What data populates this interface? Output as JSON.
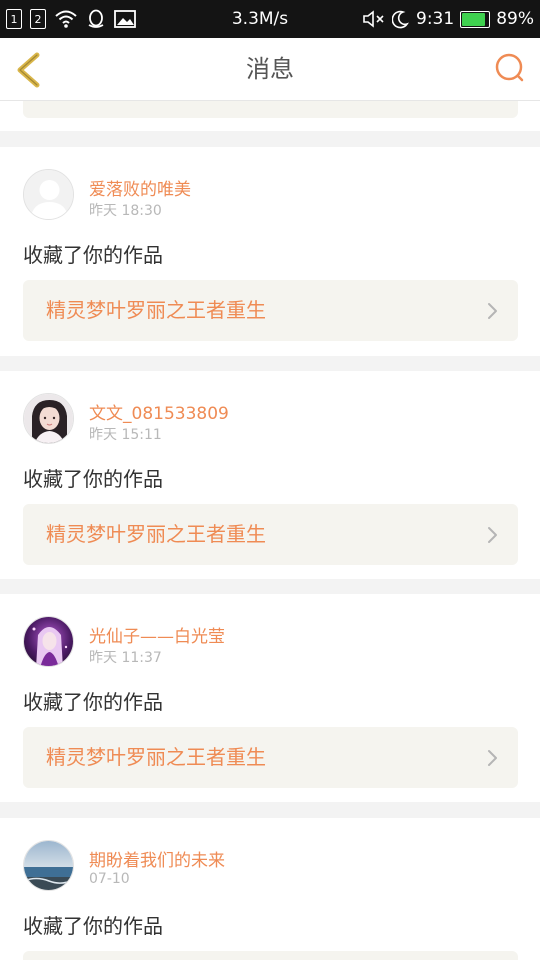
{
  "status_bar": {
    "sim1": "1",
    "sim2": "2",
    "speed": "3.3M/s",
    "time": "9:31",
    "battery": "89%",
    "battery_level": 0.89,
    "battery_color": "#3fd14f"
  },
  "header": {
    "title": "消息",
    "back_icon": "chevron-left-icon",
    "search_icon": "search-icon",
    "accent_color": "#ef8b54"
  },
  "messages": [
    {
      "username": "爱落败的唯美",
      "time": "昨天 18:30",
      "action": "收藏了你的作品",
      "work_title": "精灵梦叶罗丽之王者重生",
      "avatar": "default-avatar"
    },
    {
      "username": "文文_081533809",
      "time": "昨天 15:11",
      "action": "收藏了你的作品",
      "work_title": "精灵梦叶罗丽之王者重生",
      "avatar": "girl-photo-avatar"
    },
    {
      "username": "光仙子——白光莹",
      "time": "昨天 11:37",
      "action": "收藏了你的作品",
      "work_title": "精灵梦叶罗丽之王者重生",
      "avatar": "anime-character-avatar"
    },
    {
      "username": "期盼着我们的未来",
      "time": "07-10",
      "action": "收藏了你的作品",
      "work_title": "",
      "avatar": "seascape-avatar"
    }
  ]
}
